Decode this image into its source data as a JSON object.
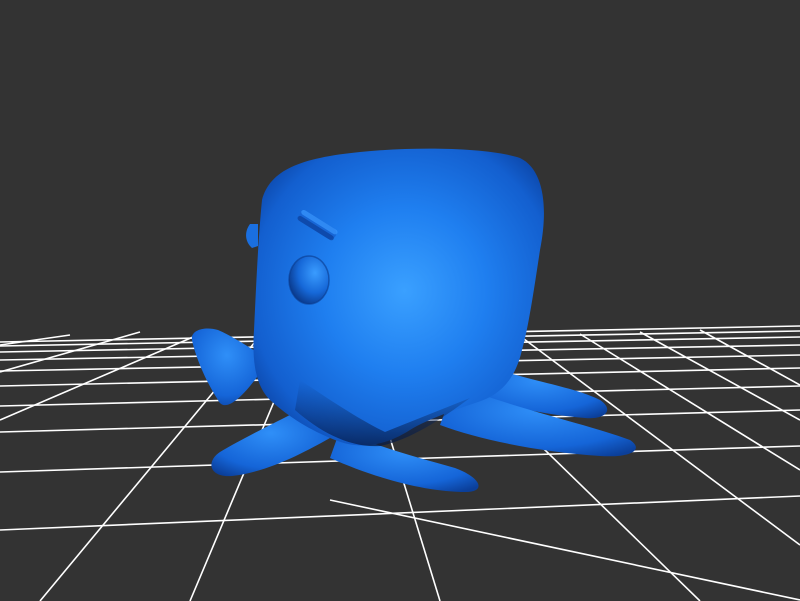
{
  "scene": {
    "background_color": "#333333",
    "grid_color": "#ffffff",
    "model_color": "#1a6fe0",
    "model_highlight_color": "#3aa0ff",
    "model_shadow_color": "#0a2a66",
    "model_subject": "octopus"
  }
}
